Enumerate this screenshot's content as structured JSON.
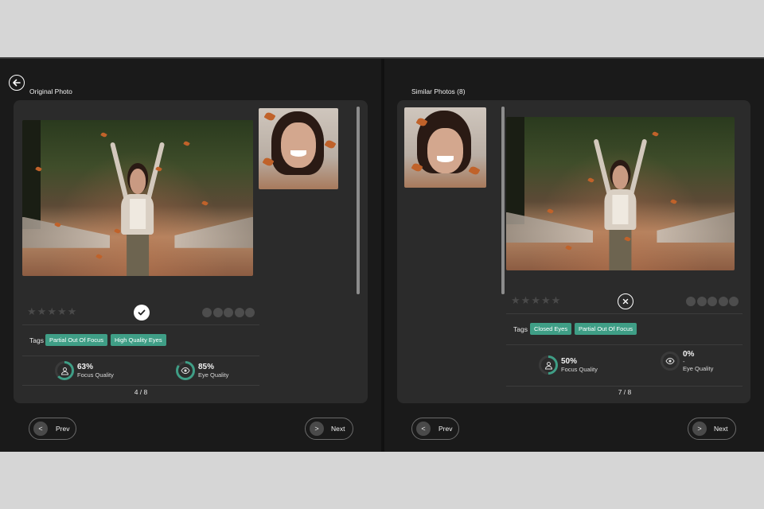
{
  "left_pane": {
    "title": "Original Photo",
    "rating_stars": 0,
    "rating_dots": 0,
    "status": "accepted",
    "tags_label": "Tags",
    "tags": [
      "Partial Out Of Focus",
      "High Quality Eyes"
    ],
    "focus": {
      "value": "63%",
      "label": "Focus Quality",
      "fraction": 0.63
    },
    "eye": {
      "value": "85%",
      "label": "Eye Quality",
      "fraction": 0.85
    },
    "pager": "4 / 8",
    "prev_label": "Prev",
    "next_label": "Next"
  },
  "right_pane": {
    "title": "Similar Photos (8)",
    "rating_stars": 0,
    "rating_dots": 0,
    "status": "rejected",
    "tags_label": "Tags",
    "tags": [
      "Closed Eyes",
      "Partial Out Of Focus"
    ],
    "focus": {
      "value": "50%",
      "label": "Focus Quality",
      "fraction": 0.5
    },
    "eye": {
      "value": "0%",
      "dash": "-",
      "label": "Eye Quality",
      "fraction": 0.0
    },
    "pager": "7 / 8",
    "prev_label": "Prev",
    "next_label": "Next"
  },
  "icons": {
    "star": "★",
    "prev_arrow": "<",
    "next_arrow": ">"
  },
  "colors": {
    "accent": "#3f9e86",
    "ring_track": "#3a3a3a",
    "background": "#1a1a1a",
    "card": "#2b2b2b"
  }
}
